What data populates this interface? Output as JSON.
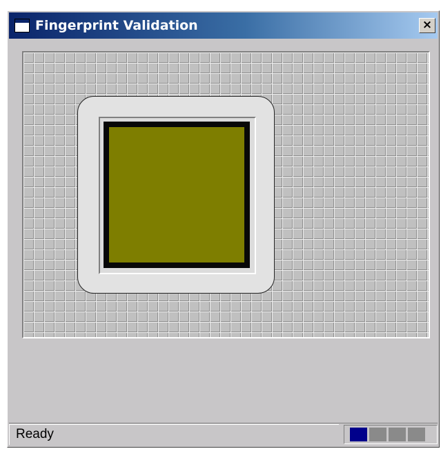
{
  "window": {
    "title": "Fingerprint Validation",
    "close_label": "×",
    "icon": "window-icon"
  },
  "sensor": {
    "pad_color": "#7e7e00",
    "frame_color": "#080808",
    "bezel_color": "#e2e2e2"
  },
  "statusbar": {
    "status_text": "Ready",
    "progress": {
      "total_cells": 4,
      "filled_cells": 1,
      "fill_color": "#00008b",
      "empty_color": "#8a8a8a"
    }
  },
  "colors": {
    "titlebar_start": "#0a246a",
    "titlebar_end": "#a6caf0",
    "window_bg": "#c8c6c8"
  }
}
